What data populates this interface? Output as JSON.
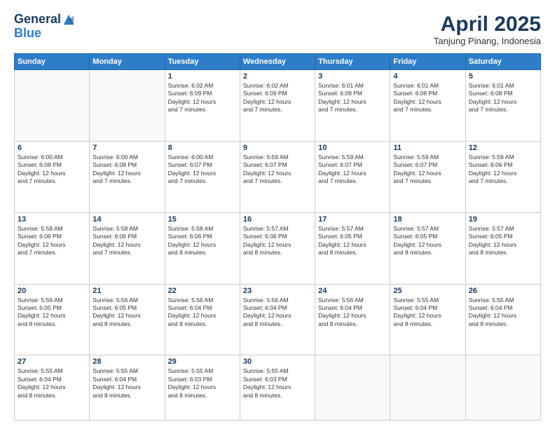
{
  "header": {
    "logo_general": "General",
    "logo_blue": "Blue",
    "month": "April 2025",
    "location": "Tanjung Pinang, Indonesia"
  },
  "weekdays": [
    "Sunday",
    "Monday",
    "Tuesday",
    "Wednesday",
    "Thursday",
    "Friday",
    "Saturday"
  ],
  "weeks": [
    [
      {
        "day": "",
        "text": ""
      },
      {
        "day": "",
        "text": ""
      },
      {
        "day": "1",
        "text": "Sunrise: 6:02 AM\nSunset: 6:09 PM\nDaylight: 12 hours\nand 7 minutes."
      },
      {
        "day": "2",
        "text": "Sunrise: 6:02 AM\nSunset: 6:09 PM\nDaylight: 12 hours\nand 7 minutes."
      },
      {
        "day": "3",
        "text": "Sunrise: 6:01 AM\nSunset: 6:09 PM\nDaylight: 12 hours\nand 7 minutes."
      },
      {
        "day": "4",
        "text": "Sunrise: 6:01 AM\nSunset: 6:08 PM\nDaylight: 12 hours\nand 7 minutes."
      },
      {
        "day": "5",
        "text": "Sunrise: 6:01 AM\nSunset: 6:08 PM\nDaylight: 12 hours\nand 7 minutes."
      }
    ],
    [
      {
        "day": "6",
        "text": "Sunrise: 6:00 AM\nSunset: 6:08 PM\nDaylight: 12 hours\nand 7 minutes."
      },
      {
        "day": "7",
        "text": "Sunrise: 6:00 AM\nSunset: 6:08 PM\nDaylight: 12 hours\nand 7 minutes."
      },
      {
        "day": "8",
        "text": "Sunrise: 6:00 AM\nSunset: 6:07 PM\nDaylight: 12 hours\nand 7 minutes."
      },
      {
        "day": "9",
        "text": "Sunrise: 5:59 AM\nSunset: 6:07 PM\nDaylight: 12 hours\nand 7 minutes."
      },
      {
        "day": "10",
        "text": "Sunrise: 5:59 AM\nSunset: 6:07 PM\nDaylight: 12 hours\nand 7 minutes."
      },
      {
        "day": "11",
        "text": "Sunrise: 5:59 AM\nSunset: 6:07 PM\nDaylight: 12 hours\nand 7 minutes."
      },
      {
        "day": "12",
        "text": "Sunrise: 5:59 AM\nSunset: 6:06 PM\nDaylight: 12 hours\nand 7 minutes."
      }
    ],
    [
      {
        "day": "13",
        "text": "Sunrise: 5:58 AM\nSunset: 6:06 PM\nDaylight: 12 hours\nand 7 minutes."
      },
      {
        "day": "14",
        "text": "Sunrise: 5:58 AM\nSunset: 6:06 PM\nDaylight: 12 hours\nand 7 minutes."
      },
      {
        "day": "15",
        "text": "Sunrise: 5:58 AM\nSunset: 6:06 PM\nDaylight: 12 hours\nand 8 minutes."
      },
      {
        "day": "16",
        "text": "Sunrise: 5:57 AM\nSunset: 6:06 PM\nDaylight: 12 hours\nand 8 minutes."
      },
      {
        "day": "17",
        "text": "Sunrise: 5:57 AM\nSunset: 6:05 PM\nDaylight: 12 hours\nand 8 minutes."
      },
      {
        "day": "18",
        "text": "Sunrise: 5:57 AM\nSunset: 6:05 PM\nDaylight: 12 hours\nand 8 minutes."
      },
      {
        "day": "19",
        "text": "Sunrise: 5:57 AM\nSunset: 6:05 PM\nDaylight: 12 hours\nand 8 minutes."
      }
    ],
    [
      {
        "day": "20",
        "text": "Sunrise: 5:56 AM\nSunset: 6:05 PM\nDaylight: 12 hours\nand 8 minutes."
      },
      {
        "day": "21",
        "text": "Sunrise: 5:56 AM\nSunset: 6:05 PM\nDaylight: 12 hours\nand 8 minutes."
      },
      {
        "day": "22",
        "text": "Sunrise: 5:56 AM\nSunset: 6:04 PM\nDaylight: 12 hours\nand 8 minutes."
      },
      {
        "day": "23",
        "text": "Sunrise: 5:56 AM\nSunset: 6:04 PM\nDaylight: 12 hours\nand 8 minutes."
      },
      {
        "day": "24",
        "text": "Sunrise: 5:56 AM\nSunset: 6:04 PM\nDaylight: 12 hours\nand 8 minutes."
      },
      {
        "day": "25",
        "text": "Sunrise: 5:55 AM\nSunset: 6:04 PM\nDaylight: 12 hours\nand 8 minutes."
      },
      {
        "day": "26",
        "text": "Sunrise: 5:55 AM\nSunset: 6:04 PM\nDaylight: 12 hours\nand 8 minutes."
      }
    ],
    [
      {
        "day": "27",
        "text": "Sunrise: 5:55 AM\nSunset: 6:04 PM\nDaylight: 12 hours\nand 8 minutes."
      },
      {
        "day": "28",
        "text": "Sunrise: 5:55 AM\nSunset: 6:04 PM\nDaylight: 12 hours\nand 8 minutes."
      },
      {
        "day": "29",
        "text": "Sunrise: 5:55 AM\nSunset: 6:03 PM\nDaylight: 12 hours\nand 8 minutes."
      },
      {
        "day": "30",
        "text": "Sunrise: 5:55 AM\nSunset: 6:03 PM\nDaylight: 12 hours\nand 8 minutes."
      },
      {
        "day": "",
        "text": ""
      },
      {
        "day": "",
        "text": ""
      },
      {
        "day": "",
        "text": ""
      }
    ]
  ]
}
